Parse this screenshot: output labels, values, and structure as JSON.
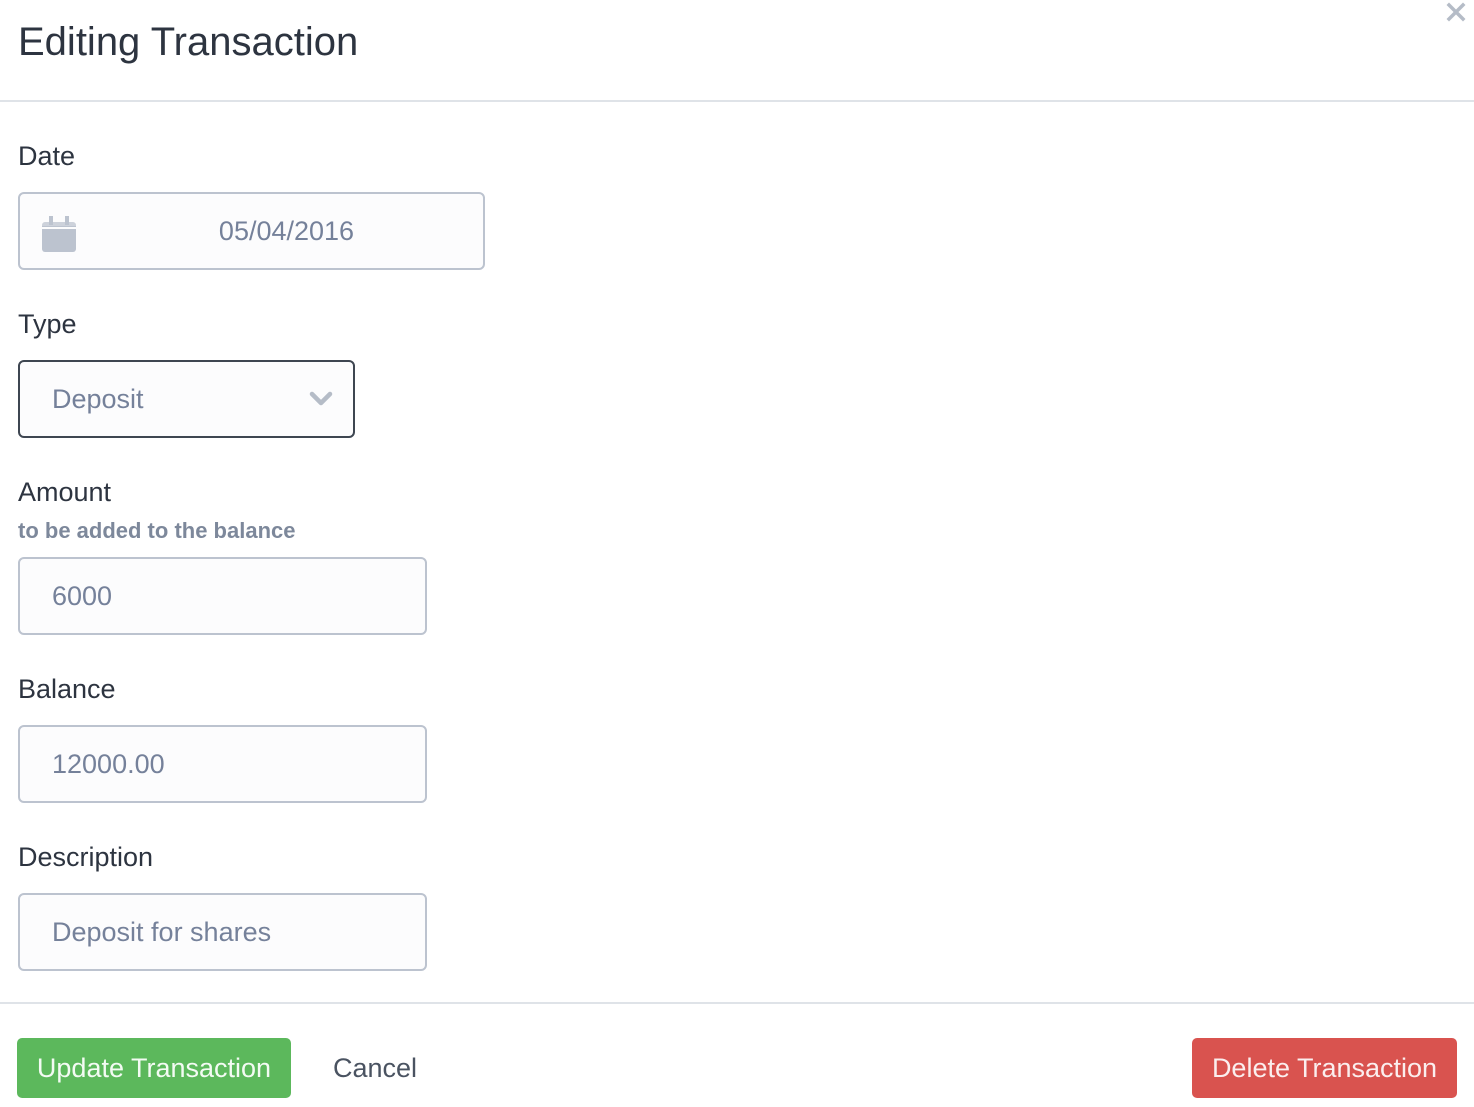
{
  "header": {
    "title": "Editing Transaction",
    "close_icon": "close-icon"
  },
  "form": {
    "date": {
      "label": "Date",
      "value": "05/04/2016",
      "icon": "calendar-icon"
    },
    "type": {
      "label": "Type",
      "selected": "Deposit",
      "icon": "chevron-down-icon"
    },
    "amount": {
      "label": "Amount",
      "help": "to be added to the balance",
      "value": "6000"
    },
    "balance": {
      "label": "Balance",
      "value": "12000.00"
    },
    "description": {
      "label": "Description",
      "value": "Deposit for shares"
    }
  },
  "footer": {
    "update_label": "Update Transaction",
    "cancel_label": "Cancel",
    "delete_label": "Delete Transaction"
  },
  "colors": {
    "success": "#5cb85c",
    "danger": "#d9534f",
    "text": "#2d3440",
    "muted": "#75819a"
  }
}
